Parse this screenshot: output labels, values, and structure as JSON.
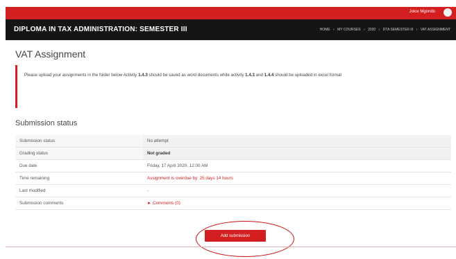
{
  "colors": {
    "accent": "#d31f1f",
    "title_bar": "#151515"
  },
  "header": {
    "user_name": "Joice Mgondo",
    "course_title": "DIPLOMA IN TAX ADMINISTRATION: SEMESTER III",
    "breadcrumb": [
      "HOME",
      "MY COURSES",
      "2020",
      "DTA SEMESTER III",
      "VAT ASSIGNMENT"
    ]
  },
  "page": {
    "title": "VAT Assignment",
    "notice_part1": "Please upload your assignments in the folder below Activity ",
    "notice_b1": "1.4.3",
    "notice_part2": " should be saved as word documents while activity ",
    "notice_b2": "1.4.3",
    "notice_part3": " and ",
    "notice_b3": "1.4.4",
    "notice_part4": " should be uploaded in excel format"
  },
  "submission": {
    "section_title": "Submission status",
    "rows": [
      {
        "label": "Submission status",
        "value": "No attempt"
      },
      {
        "label": "Grading status",
        "value": "Not graded"
      },
      {
        "label": "Due date",
        "value": "Friday, 17 April 2020, 12:00 AM"
      },
      {
        "label": "Time remaining",
        "value": "Assignment is overdue by: 25 days 14 hours"
      },
      {
        "label": "Last modified",
        "value": "-"
      },
      {
        "label": "Submission comments",
        "value": "► Comments (0)"
      }
    ],
    "add_button": "Add submission"
  }
}
